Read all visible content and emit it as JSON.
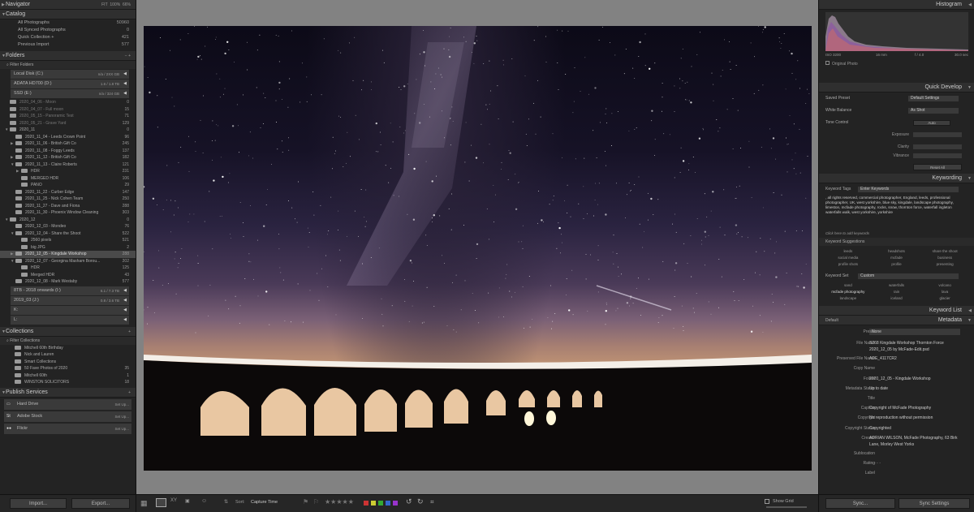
{
  "left": {
    "navigator": {
      "title": "Navigator",
      "fit": "FIT",
      "z1": "100%",
      "z2": "66%"
    },
    "catalog": {
      "title": "Catalog",
      "items": [
        {
          "label": "All Photographs",
          "count": "50960"
        },
        {
          "label": "All Synced Photographs",
          "count": "0"
        },
        {
          "label": "Quick Collection +",
          "count": "421"
        },
        {
          "label": "Previous Import",
          "count": "577"
        }
      ]
    },
    "folders": {
      "title": "Folders",
      "controls": "− +",
      "filter": "Filter Folders",
      "volumes": [
        {
          "name": "Local Disk (C:)",
          "info": "n/a / 2XX GB"
        },
        {
          "name": "ADATA HD700 (D:)",
          "info": "1.6 / 1.8 TB"
        },
        {
          "name": "SSD (E:)",
          "info": "n/a / 324 GB"
        }
      ],
      "tree": [
        {
          "label": "2020_04_06 - Moon",
          "count": "0",
          "indent": 1,
          "dim": true
        },
        {
          "label": "2020_04_07 - Full moon",
          "count": "15",
          "indent": 1,
          "dim": true
        },
        {
          "label": "2020_05_15 - Panoramic Test",
          "count": "71",
          "indent": 1,
          "dim": true
        },
        {
          "label": "2020_05_21 - Grave Yard",
          "count": "129",
          "indent": 1,
          "dim": true
        },
        {
          "label": "2020_11",
          "count": "0",
          "indent": 1,
          "arrow": "▼"
        },
        {
          "label": "2020_11_04 - Leeds Crown Point",
          "count": "96",
          "indent": 2
        },
        {
          "label": "2020_11_06 - British Gift Co",
          "count": "245",
          "indent": 2,
          "arrow": "▶"
        },
        {
          "label": "2020_11_08 - Foggy Leeds",
          "count": "137",
          "indent": 2
        },
        {
          "label": "2020_11_12 - British Gift Co",
          "count": "182",
          "indent": 2,
          "arrow": "▶"
        },
        {
          "label": "2020_11_13 - Claire Roberts",
          "count": "121",
          "indent": 2,
          "arrow": "▼"
        },
        {
          "label": "HDR",
          "count": "231",
          "indent": 3,
          "arrow": "▶"
        },
        {
          "label": "MERGED HDR",
          "count": "106",
          "indent": 3
        },
        {
          "label": "PANO",
          "count": "29",
          "indent": 3
        },
        {
          "label": "2020_11_22 - Curber Edge",
          "count": "147",
          "indent": 2
        },
        {
          "label": "2020_11_25 - Nick Cohen Team",
          "count": "250",
          "indent": 2
        },
        {
          "label": "2020_11_27 - Dave and Fiona",
          "count": "288",
          "indent": 2
        },
        {
          "label": "2020_11_30 - Phoenix Window Cleaning",
          "count": "303",
          "indent": 2
        },
        {
          "label": "2020_12",
          "count": "0",
          "indent": 1,
          "arrow": "▼"
        },
        {
          "label": "2020_12_03 - Mondeo",
          "count": "76",
          "indent": 2
        },
        {
          "label": "2020_12_04 - Share the Shoot",
          "count": "522",
          "indent": 2,
          "arrow": "▼"
        },
        {
          "label": "2560 pixels",
          "count": "521",
          "indent": 3
        },
        {
          "label": "big JPG",
          "count": "2",
          "indent": 3
        },
        {
          "label": "2020_12_05 - Kingdale Workshop",
          "count": "288",
          "indent": 2,
          "arrow": "▶",
          "sel": true
        },
        {
          "label": "2020_12_07 - Georgina Masham Borou...",
          "count": "202",
          "indent": 2,
          "arrow": "▼"
        },
        {
          "label": "HDR",
          "count": "125",
          "indent": 3
        },
        {
          "label": "Merged HDR",
          "count": "43",
          "indent": 3
        },
        {
          "label": "2020_12_08 - Mark Westaby",
          "count": "577",
          "indent": 2
        }
      ],
      "volumes2": [
        {
          "name": "8TB - 2018 onwards (I:)",
          "info": "6.1 / 7.3 TB"
        },
        {
          "name": "2019_03 (J:)",
          "info": "0.8 / 3.6 TB"
        },
        {
          "name": "K:",
          "info": ""
        },
        {
          "name": "L:",
          "info": ""
        }
      ]
    },
    "collections": {
      "title": "Collections",
      "filter": "Filter Collections",
      "items": [
        {
          "label": "Mitchell 60th Birthday",
          "count": ""
        },
        {
          "label": "Nick and Lauren",
          "count": ""
        },
        {
          "label": "Smart Collections",
          "count": ""
        },
        {
          "label": "50 Fave Photos of 2020",
          "count": "35"
        },
        {
          "label": "Mitchell 60th",
          "count": "1"
        },
        {
          "label": "WINSTON SOLICITORS",
          "count": "18"
        }
      ]
    },
    "publish": {
      "title": "Publish Services",
      "items": [
        {
          "label": "Hard Drive",
          "action": "Set Up..."
        },
        {
          "label": "Adobe Stock",
          "action": "Set Up..."
        },
        {
          "label": "Flickr",
          "action": "Set Up..."
        }
      ]
    },
    "import_label": "Import...",
    "export_label": "Export..."
  },
  "toolbar": {
    "sort_label": "Sort:",
    "sort_value": "Capture Time",
    "stars": "★★★★★",
    "show_grid": "Show Grid"
  },
  "right": {
    "histogram": {
      "title": "Histogram",
      "iso": "ISO 3200",
      "focal": "16 mm",
      "aperture": "f / 4.0",
      "shutter": "30.0 sec",
      "original": "Original Photo"
    },
    "quick": {
      "title": "Quick Develop",
      "saved_preset_label": "Saved Preset",
      "saved_preset_value": "Default Settings",
      "wb_label": "White Balance",
      "wb_value": "As Shot",
      "tone_label": "Tone Control",
      "auto": "Auto",
      "exposure": "Exposure",
      "clarity": "Clarity",
      "vibrance": "Vibrance",
      "reset": "Reset All"
    },
    "keywording": {
      "title": "Keywording",
      "tags_label": "Keyword Tags",
      "tags_value": "Enter Keywords",
      "keywords": ", all rights reserved, commercial photographer, England, leeds, professional photographer, UK, west yorkshire, blue sky, kingdale, landscape photography, limeston, mcfade photography, rocks, snow, thornton force, waterfall ingleton waterfalls walk, west yorkshire, yorkshire",
      "click_add": "Click here to add keywords",
      "suggestions_label": "Keyword Suggestions",
      "suggestions": [
        "leeds",
        "headshots",
        "share the shoot",
        "social media",
        "mcfade",
        "business",
        "profile shots",
        "profile",
        "presenting"
      ],
      "set_label": "Keyword Set",
      "set_value": "Custom",
      "set": [
        "sand",
        "waterfalls",
        "volcano",
        "mcfade photography",
        "rain",
        "lava",
        "landscape",
        "iceland",
        "glacier"
      ]
    },
    "keyword_list": {
      "title": "Keyword List"
    },
    "metadata": {
      "title": "Metadata",
      "default": "Default",
      "preset_label": "Preset",
      "preset_value": "None",
      "fields": [
        {
          "k": "File Name",
          "v": "S268 Kingdale Workshop Thornton Force 2020_12_05 by McFade-Edit.psd"
        },
        {
          "k": "Preserved File Name",
          "v": "ADE_4117CR2"
        },
        {
          "k": "Copy Name",
          "v": ""
        },
        {
          "k": "Folder",
          "v": "2020_12_05 - Kingdale Workshop"
        },
        {
          "k": "Metadata Status",
          "v": "Up to date"
        },
        {
          "k": "Title",
          "v": ""
        },
        {
          "k": "Caption",
          "v": "Copyright of McFade Photography"
        },
        {
          "k": "Copyright",
          "v": "No reproduction without permission"
        },
        {
          "k": "Copyright Status",
          "v": "Copyrighted"
        },
        {
          "k": "Creator",
          "v": "ADRIAN WILSON, McFade Photography, 63 Birk Lane, Morley West Yorks"
        },
        {
          "k": "Sublocation",
          "v": ""
        },
        {
          "k": "Rating",
          "v": "· · · · ·"
        },
        {
          "k": "Label",
          "v": ""
        }
      ]
    },
    "sync": "Sync...",
    "sync_settings": "Sync Settings"
  },
  "colors": {
    "accent": "#4a4a4a",
    "panel": "#232323",
    "photo_bg": "#828282"
  }
}
